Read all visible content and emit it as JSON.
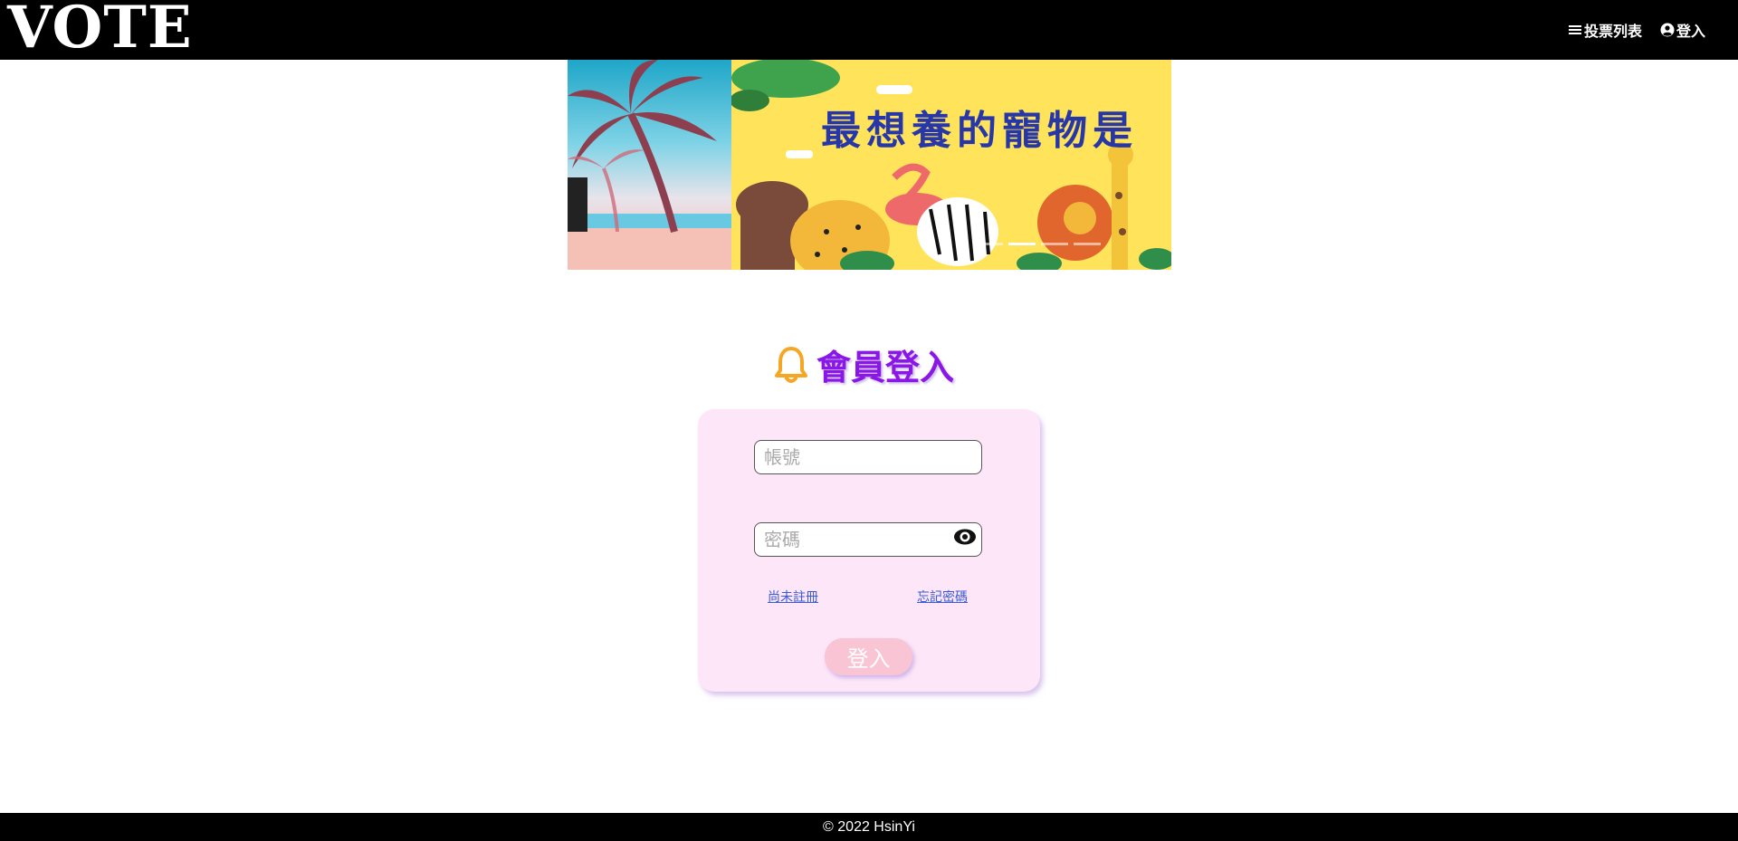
{
  "header": {
    "logo": "VOTE",
    "nav": [
      {
        "label": "投票列表",
        "icon": "menu-icon"
      },
      {
        "label": "登入",
        "icon": "user-circle-icon"
      }
    ]
  },
  "banner": {
    "title": "最想養的寵物是",
    "slides_count": 5,
    "active_slide_index": 1
  },
  "login": {
    "title": "會員登入",
    "title_icon": "bell-icon",
    "username_placeholder": "帳號",
    "password_placeholder": "密碼",
    "register_link": "尚未註冊",
    "forgot_link": "忘記密碼",
    "submit_label": "登入"
  },
  "footer": {
    "text": "© 2022 HsinYi"
  },
  "colors": {
    "header_bg": "#000000",
    "title": "#8a16e8",
    "bell": "#f5a623",
    "card_bg": "#fce6f7",
    "button_bg": "#f9c4d3",
    "link": "#3a5bd8"
  }
}
